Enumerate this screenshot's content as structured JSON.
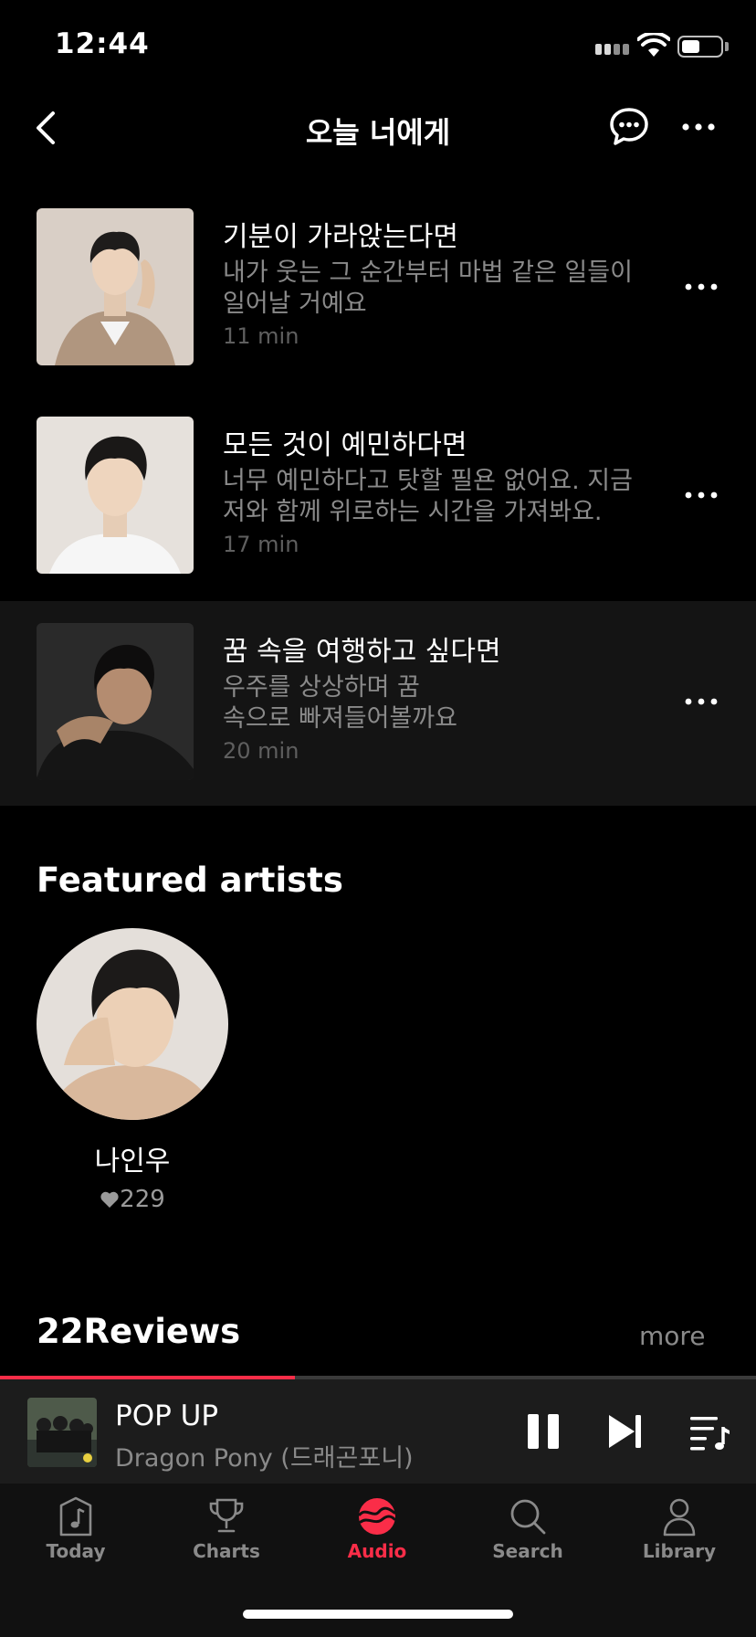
{
  "status_bar": {
    "time": "12:44",
    "battery_level": 0.55
  },
  "header": {
    "title": "오늘 너에게"
  },
  "episodes": [
    {
      "title": "기분이 가라앉는다면",
      "desc_line1": "내가 웃는 그 순간부터 마법 같은 일들이",
      "desc_line2": "일어날 거예요",
      "duration": "11 min",
      "thumb_color": "#d9cfc6"
    },
    {
      "title": "모든 것이 예민하다면",
      "desc_line1": "너무 예민하다고 탓할 필욘 없어요. 지금",
      "desc_line2": "저와 함께 위로하는 시간을 가져봐요.",
      "duration": "17 min",
      "thumb_color": "#e6e1dc"
    },
    {
      "title": "꿈 속을 여행하고 싶다면",
      "desc_line1": "우주를 상상하며 꿈",
      "desc_line2": "속으로 빠져들어볼까요",
      "duration": "20 min",
      "thumb_color": "#2a2a2a"
    }
  ],
  "featured": {
    "title": "Featured artists",
    "artist": {
      "name": "나인우",
      "likes": "229"
    }
  },
  "reviews": {
    "title": "22Reviews",
    "more": "more"
  },
  "player": {
    "title": "POP UP",
    "artist": "Dragon Pony (드래곤포니)",
    "progress": 0.39
  },
  "tabs": [
    {
      "label": "Today",
      "icon": "music-note-icon"
    },
    {
      "label": "Charts",
      "icon": "trophy-icon"
    },
    {
      "label": "Audio",
      "icon": "audio-icon"
    },
    {
      "label": "Search",
      "icon": "search-icon"
    },
    {
      "label": "Library",
      "icon": "person-icon"
    }
  ],
  "colors": {
    "accent": "#fa2d48",
    "background": "#000000",
    "secondary_text": "#8a8a8a"
  }
}
